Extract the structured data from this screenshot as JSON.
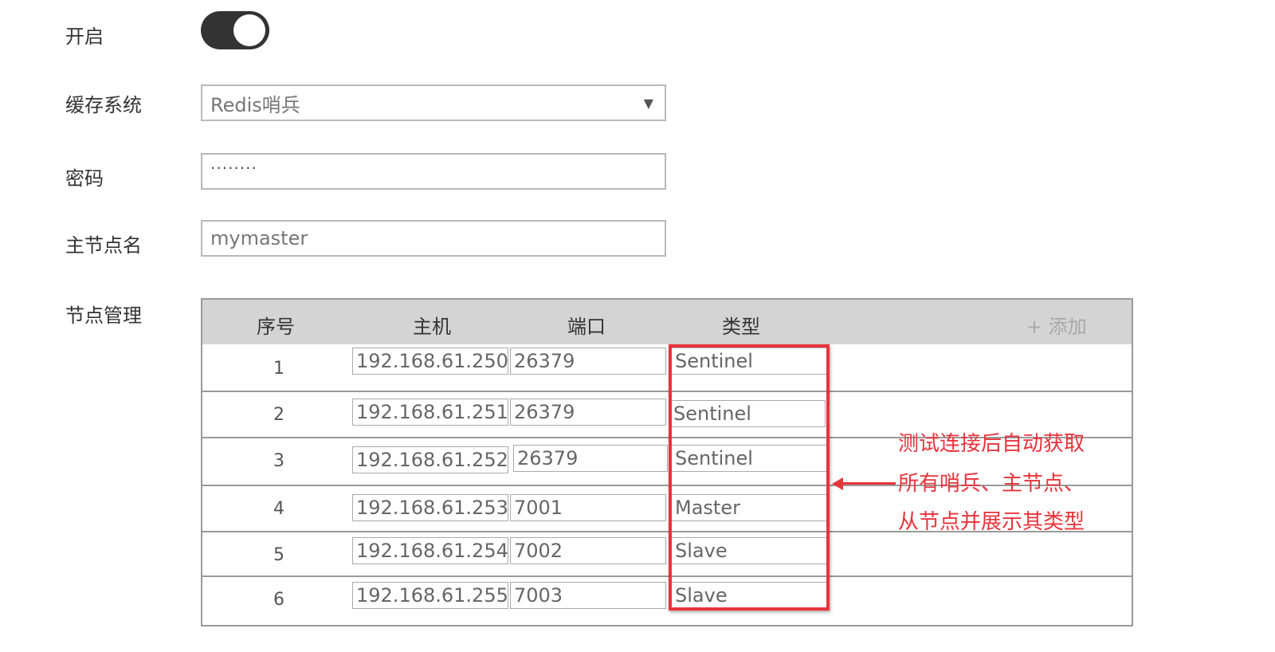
{
  "form": {
    "enable_label": "开启",
    "enable_on": true,
    "cache_label": "缓存系统",
    "cache_value": "Redis哨兵",
    "cache_arrow": "▼",
    "password_label": "密码",
    "password_value": "········",
    "master_label": "主节点名",
    "master_value": "mymaster",
    "nodes_label": "节点管理"
  },
  "table": {
    "headers": {
      "index": "序号",
      "host": "主机",
      "port": "端口",
      "type": "类型",
      "add": "+ 添加"
    },
    "rows": [
      {
        "index": "1",
        "host": "192.168.61.250",
        "port": "26379",
        "type": "Sentinel"
      },
      {
        "index": "2",
        "host": "192.168.61.251",
        "port": "26379",
        "type": "Sentinel"
      },
      {
        "index": "3",
        "host": "192.168.61.252",
        "port": "26379",
        "type": "Sentinel"
      },
      {
        "index": "4",
        "host": "192.168.61.253",
        "port": "7001",
        "type": "Master"
      },
      {
        "index": "5",
        "host": "192.168.61.254",
        "port": "7002",
        "type": "Slave"
      },
      {
        "index": "6",
        "host": "192.168.61.255",
        "port": "7003",
        "type": "Slave"
      }
    ]
  },
  "annotation": {
    "lines": [
      "测试连接后自动获取",
      "所有哨兵、主节点、",
      "从节点并展示其类型"
    ],
    "color": "#e8343c"
  }
}
